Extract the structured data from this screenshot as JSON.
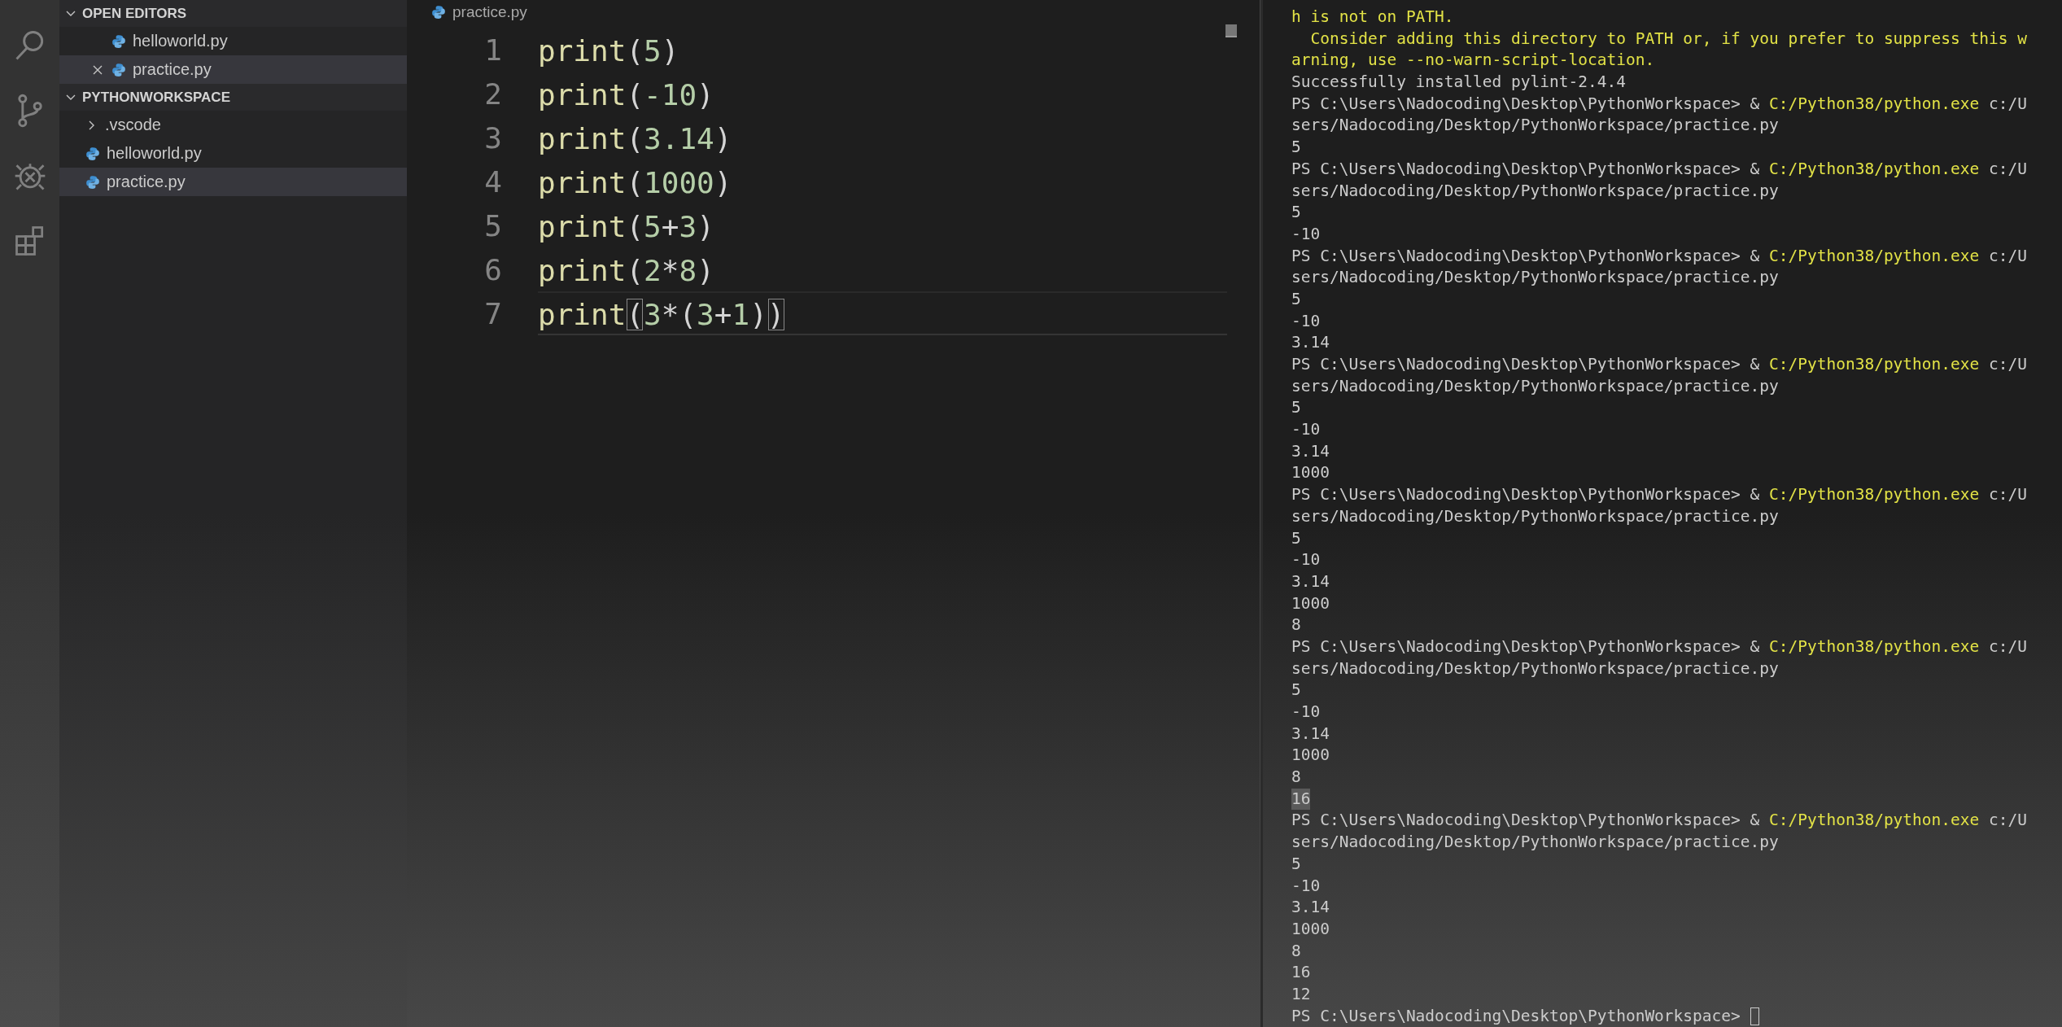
{
  "activity_bar": {
    "items": [
      {
        "kind": "search",
        "selected": false
      },
      {
        "kind": "source-control",
        "selected": false
      },
      {
        "kind": "debug",
        "selected": false
      },
      {
        "kind": "extensions",
        "selected": false
      }
    ]
  },
  "sidebar": {
    "sections": [
      {
        "title": "OPEN EDITORS",
        "expanded": true,
        "items": [
          {
            "label": "helloworld.py",
            "kind": "python-file",
            "selected": false,
            "closable": false
          },
          {
            "label": "practice.py",
            "kind": "python-file",
            "selected": true,
            "closable": true
          }
        ]
      },
      {
        "title": "PYTHONWORKSPACE",
        "expanded": true,
        "items": [
          {
            "label": ".vscode",
            "kind": "folder",
            "selected": false
          },
          {
            "label": "helloworld.py",
            "kind": "python-file",
            "selected": false
          },
          {
            "label": "practice.py",
            "kind": "python-file",
            "selected": true
          }
        ]
      }
    ]
  },
  "editor": {
    "breadcrumb": "practice.py",
    "lines": [
      {
        "number": "1",
        "current": false,
        "tokens": [
          {
            "text": "print",
            "kind": "function"
          },
          {
            "text": "(",
            "kind": "punct"
          },
          {
            "text": "5",
            "kind": "number"
          },
          {
            "text": ")",
            "kind": "punct"
          }
        ]
      },
      {
        "number": "2",
        "current": false,
        "tokens": [
          {
            "text": "print",
            "kind": "function"
          },
          {
            "text": "(",
            "kind": "punct"
          },
          {
            "text": "-10",
            "kind": "number"
          },
          {
            "text": ")",
            "kind": "punct"
          }
        ]
      },
      {
        "number": "3",
        "current": false,
        "tokens": [
          {
            "text": "print",
            "kind": "function"
          },
          {
            "text": "(",
            "kind": "punct"
          },
          {
            "text": "3.14",
            "kind": "number"
          },
          {
            "text": ")",
            "kind": "punct"
          }
        ]
      },
      {
        "number": "4",
        "current": false,
        "tokens": [
          {
            "text": "print",
            "kind": "function"
          },
          {
            "text": "(",
            "kind": "punct"
          },
          {
            "text": "1000",
            "kind": "number"
          },
          {
            "text": ")",
            "kind": "punct"
          }
        ]
      },
      {
        "number": "5",
        "current": false,
        "tokens": [
          {
            "text": "print",
            "kind": "function"
          },
          {
            "text": "(",
            "kind": "punct"
          },
          {
            "text": "5",
            "kind": "number"
          },
          {
            "text": "+",
            "kind": "punct"
          },
          {
            "text": "3",
            "kind": "number"
          },
          {
            "text": ")",
            "kind": "punct"
          }
        ]
      },
      {
        "number": "6",
        "current": false,
        "tokens": [
          {
            "text": "print",
            "kind": "function"
          },
          {
            "text": "(",
            "kind": "punct"
          },
          {
            "text": "2",
            "kind": "number"
          },
          {
            "text": "*",
            "kind": "punct"
          },
          {
            "text": "8",
            "kind": "number"
          },
          {
            "text": ")",
            "kind": "punct"
          }
        ]
      },
      {
        "number": "7",
        "current": true,
        "tokens": [
          {
            "text": "print",
            "kind": "function"
          },
          {
            "text": "(",
            "kind": "bracket-match"
          },
          {
            "text": "3",
            "kind": "number"
          },
          {
            "text": "*(",
            "kind": "punct"
          },
          {
            "text": "3",
            "kind": "number"
          },
          {
            "text": "+",
            "kind": "punct"
          },
          {
            "text": "1",
            "kind": "number"
          },
          {
            "text": ")",
            "kind": "punct"
          },
          {
            "text": ")",
            "kind": "bracket-match"
          }
        ]
      }
    ]
  },
  "terminal": {
    "lines": [
      {
        "kind": "warning",
        "text": "h is not on PATH."
      },
      {
        "kind": "warning",
        "text": "  Consider adding this directory to PATH or, if you prefer to suppress this w"
      },
      {
        "kind": "warning",
        "text": "arning, use --no-warn-script-location."
      },
      {
        "kind": "output",
        "text": "Successfully installed pylint-2.4.4"
      },
      {
        "kind": "command",
        "prompt": "PS C:\\Users\\Nadocoding\\Desktop\\PythonWorkspace> & ",
        "path": "C:/Python38/python.exe",
        "rest": " c:/U"
      },
      {
        "kind": "output",
        "text": "sers/Nadocoding/Desktop/PythonWorkspace/practice.py"
      },
      {
        "kind": "output",
        "text": "5"
      },
      {
        "kind": "command",
        "prompt": "PS C:\\Users\\Nadocoding\\Desktop\\PythonWorkspace> & ",
        "path": "C:/Python38/python.exe",
        "rest": " c:/U"
      },
      {
        "kind": "output",
        "text": "sers/Nadocoding/Desktop/PythonWorkspace/practice.py"
      },
      {
        "kind": "output",
        "text": "5"
      },
      {
        "kind": "output",
        "text": "-10"
      },
      {
        "kind": "command",
        "prompt": "PS C:\\Users\\Nadocoding\\Desktop\\PythonWorkspace> & ",
        "path": "C:/Python38/python.exe",
        "rest": " c:/U"
      },
      {
        "kind": "output",
        "text": "sers/Nadocoding/Desktop/PythonWorkspace/practice.py"
      },
      {
        "kind": "output",
        "text": "5"
      },
      {
        "kind": "output",
        "text": "-10"
      },
      {
        "kind": "output",
        "text": "3.14"
      },
      {
        "kind": "command",
        "prompt": "PS C:\\Users\\Nadocoding\\Desktop\\PythonWorkspace> & ",
        "path": "C:/Python38/python.exe",
        "rest": " c:/U"
      },
      {
        "kind": "output",
        "text": "sers/Nadocoding/Desktop/PythonWorkspace/practice.py"
      },
      {
        "kind": "output",
        "text": "5"
      },
      {
        "kind": "output",
        "text": "-10"
      },
      {
        "kind": "output",
        "text": "3.14"
      },
      {
        "kind": "output",
        "text": "1000"
      },
      {
        "kind": "command",
        "prompt": "PS C:\\Users\\Nadocoding\\Desktop\\PythonWorkspace> & ",
        "path": "C:/Python38/python.exe",
        "rest": " c:/U"
      },
      {
        "kind": "output",
        "text": "sers/Nadocoding/Desktop/PythonWorkspace/practice.py"
      },
      {
        "kind": "output",
        "text": "5"
      },
      {
        "kind": "output",
        "text": "-10"
      },
      {
        "kind": "output",
        "text": "3.14"
      },
      {
        "kind": "output",
        "text": "1000"
      },
      {
        "kind": "output",
        "text": "8"
      },
      {
        "kind": "command",
        "prompt": "PS C:\\Users\\Nadocoding\\Desktop\\PythonWorkspace> & ",
        "path": "C:/Python38/python.exe",
        "rest": " c:/U"
      },
      {
        "kind": "output",
        "text": "sers/Nadocoding/Desktop/PythonWorkspace/practice.py"
      },
      {
        "kind": "output",
        "text": "5"
      },
      {
        "kind": "output",
        "text": "-10"
      },
      {
        "kind": "output",
        "text": "3.14"
      },
      {
        "kind": "output",
        "text": "1000"
      },
      {
        "kind": "output",
        "text": "8"
      },
      {
        "kind": "highlighted",
        "text": "16"
      },
      {
        "kind": "command",
        "prompt": "PS C:\\Users\\Nadocoding\\Desktop\\PythonWorkspace> & ",
        "path": "C:/Python38/python.exe",
        "rest": " c:/U"
      },
      {
        "kind": "output",
        "text": "sers/Nadocoding/Desktop/PythonWorkspace/practice.py"
      },
      {
        "kind": "output",
        "text": "5"
      },
      {
        "kind": "output",
        "text": "-10"
      },
      {
        "kind": "output",
        "text": "3.14"
      },
      {
        "kind": "output",
        "text": "1000"
      },
      {
        "kind": "output",
        "text": "8"
      },
      {
        "kind": "output",
        "text": "16"
      },
      {
        "kind": "output",
        "text": "12"
      },
      {
        "kind": "prompt",
        "text": "PS C:\\Users\\Nadocoding\\Desktop\\PythonWorkspace> "
      }
    ]
  }
}
